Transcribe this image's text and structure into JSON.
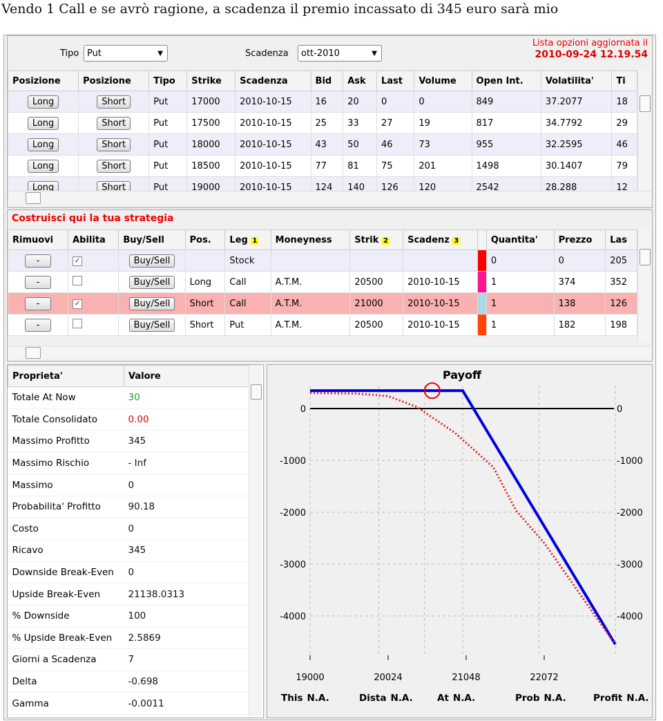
{
  "caption": "Vendo 1 Call e se avrò ragione,  a scadenza il premio incassato di 345 euro sarà mio",
  "filters": {
    "tipo_label": "Tipo",
    "tipo_value": "Put",
    "scadenza_label": "Scadenza",
    "scadenza_value": "ott-2010",
    "updated_label": "Lista opzioni aggiornata il",
    "updated_value": "2010-09-24 12.19.54"
  },
  "options_table": {
    "headers": [
      "Posizione",
      "Posizione",
      "Tipo",
      "Strike",
      "Scadenza",
      "Bid",
      "Ask",
      "Last",
      "Volume",
      "Open Int.",
      "Volatilita'",
      "Ti"
    ],
    "long_label": "Long",
    "short_label": "Short",
    "rows": [
      [
        "Put",
        "17000",
        "2010-10-15",
        "16",
        "20",
        "0",
        "0",
        "849",
        "37.2077",
        "18"
      ],
      [
        "Put",
        "17500",
        "2010-10-15",
        "25",
        "33",
        "27",
        "19",
        "817",
        "34.7792",
        "29"
      ],
      [
        "Put",
        "18000",
        "2010-10-15",
        "43",
        "50",
        "46",
        "73",
        "955",
        "32.2595",
        "46"
      ],
      [
        "Put",
        "18500",
        "2010-10-15",
        "77",
        "81",
        "75",
        "201",
        "1498",
        "30.1407",
        "79"
      ],
      [
        "Put",
        "19000",
        "2010-10-15",
        "124",
        "140",
        "126",
        "120",
        "2542",
        "28.288",
        "12"
      ]
    ]
  },
  "strategy": {
    "title": "Costruisci qui la tua strategia",
    "headers": [
      "Rimuovi",
      "Abilita",
      "Buy/Sell",
      "Pos.",
      "Leg",
      "Moneyness",
      "Strik",
      "Scadenz",
      "",
      "Quantita'",
      "Prezzo",
      "Las"
    ],
    "sort_badges": [
      "1",
      "2",
      "3"
    ],
    "remove_label": "-",
    "buysell_label": "Buy/Sell",
    "rows": [
      {
        "checked": true,
        "pos": "",
        "leg": "Stock",
        "money": "",
        "strike": "",
        "exp": "",
        "color": "#ff0000",
        "qty": "0",
        "price": "0",
        "last": "205"
      },
      {
        "checked": false,
        "pos": "Long",
        "leg": "Call",
        "money": "A.T.M.",
        "strike": "20500",
        "exp": "2010-10-15",
        "color": "#ff1493",
        "qty": "1",
        "price": "374",
        "last": "352"
      },
      {
        "checked": true,
        "pos": "Short",
        "leg": "Call",
        "money": "A.T.M.",
        "strike": "21000",
        "exp": "2010-10-15",
        "color": "#add8e6",
        "qty": "1",
        "price": "138",
        "last": "126",
        "selected": true
      },
      {
        "checked": false,
        "pos": "Short",
        "leg": "Put",
        "money": "A.T.M.",
        "strike": "20500",
        "exp": "2010-10-15",
        "color": "#ff4500",
        "qty": "1",
        "price": "182",
        "last": "198"
      }
    ]
  },
  "properties": {
    "headers": [
      "Proprieta'",
      "Valore"
    ],
    "rows": [
      [
        "Totale At Now",
        "30",
        "#2a9a2a"
      ],
      [
        "Totale Consolidato",
        "0.00",
        "#e00000"
      ],
      [
        "Massimo Profitto",
        "345",
        ""
      ],
      [
        "Massimo Rischio",
        "- Inf",
        ""
      ],
      [
        "Massimo",
        "0",
        ""
      ],
      [
        "Probabilita' Profitto",
        "90.18",
        ""
      ],
      [
        "Costo",
        "0",
        ""
      ],
      [
        "Ricavo",
        "345",
        ""
      ],
      [
        "Downside Break-Even",
        "0",
        ""
      ],
      [
        "Upside Break-Even",
        "21138.0313",
        ""
      ],
      [
        "% Downside",
        "100",
        ""
      ],
      [
        "% Upside Break-Even",
        "2.5869",
        ""
      ],
      [
        "Giorni a Scadenza",
        "7",
        ""
      ],
      [
        "Delta",
        "-0.698",
        ""
      ],
      [
        "Gamma",
        "-0.0011",
        ""
      ]
    ]
  },
  "chart_data": {
    "type": "line",
    "title": "Payoff",
    "x_ticks": [
      "19000",
      "20024",
      "21048",
      "22072"
    ],
    "y_ticks": [
      "0",
      "-1000",
      "-2000",
      "-3000",
      "-4000"
    ],
    "ylim": [
      -4800,
      650
    ],
    "xlim": [
      19000,
      23000
    ],
    "grid": true,
    "series": [
      {
        "style": "solid",
        "color": "#0000e0",
        "points": [
          [
            19000,
            345
          ],
          [
            21000,
            345
          ],
          [
            23000,
            -4550
          ]
        ]
      },
      {
        "style": "dotted",
        "color": "#e02020",
        "points": [
          [
            19000,
            300
          ],
          [
            19600,
            290
          ],
          [
            20024,
            240
          ],
          [
            20400,
            30
          ],
          [
            20900,
            -470
          ],
          [
            21400,
            -1130
          ],
          [
            21700,
            -1970
          ],
          [
            22072,
            -2600
          ],
          [
            23000,
            -4550
          ]
        ]
      }
    ],
    "marker": {
      "x": 20600,
      "y": 345,
      "color": "#e00000"
    },
    "footer": [
      [
        "This",
        "N.A."
      ],
      [
        "Dista",
        "N.A."
      ],
      [
        "At",
        "N.A."
      ],
      [
        "Prob",
        "N.A."
      ],
      [
        "Profit",
        "N.A."
      ]
    ]
  }
}
